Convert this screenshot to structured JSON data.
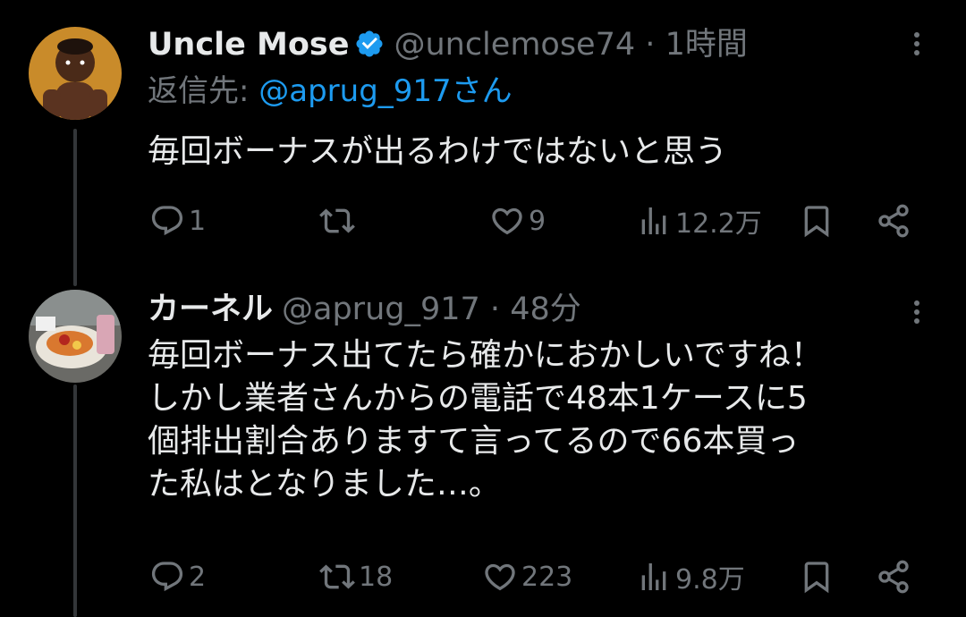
{
  "tweets": [
    {
      "name": "Uncle Mose",
      "handle": "@unclemose74",
      "separator": "·",
      "time": "1時間",
      "replying_prefix": "返信先: ",
      "replying_to": "@aprug_917さん",
      "text": "毎回ボーナスが出るわけではないと思う",
      "replies": "1",
      "retweets": "",
      "likes": "9",
      "views": "12.2万",
      "verified": true
    },
    {
      "name": "カーネル",
      "handle": "@aprug_917",
      "separator": "·",
      "time": "48分",
      "text": "毎回ボーナス出てたら確かにおかしいですね！\nしかし業者さんからの電話で48本1ケースに5\n個排出割合ありますて言ってるので66本買っ\nた私はとなりました…。",
      "replies": "2",
      "retweets": "18",
      "likes": "223",
      "views": "9.8万",
      "verified": false
    }
  ],
  "colors": {
    "background": "#000000",
    "text": "#e7e9ea",
    "muted": "#71767b",
    "accent": "#1d9bf0",
    "thread_line": "#333639"
  },
  "icons": {
    "verified": "verified-badge-icon",
    "more": "more-dots-icon",
    "reply": "reply-bubble-icon",
    "retweet": "retweet-icon",
    "like": "heart-icon",
    "views": "views-bar-chart-icon",
    "bookmark": "bookmark-icon",
    "share": "share-icon"
  }
}
